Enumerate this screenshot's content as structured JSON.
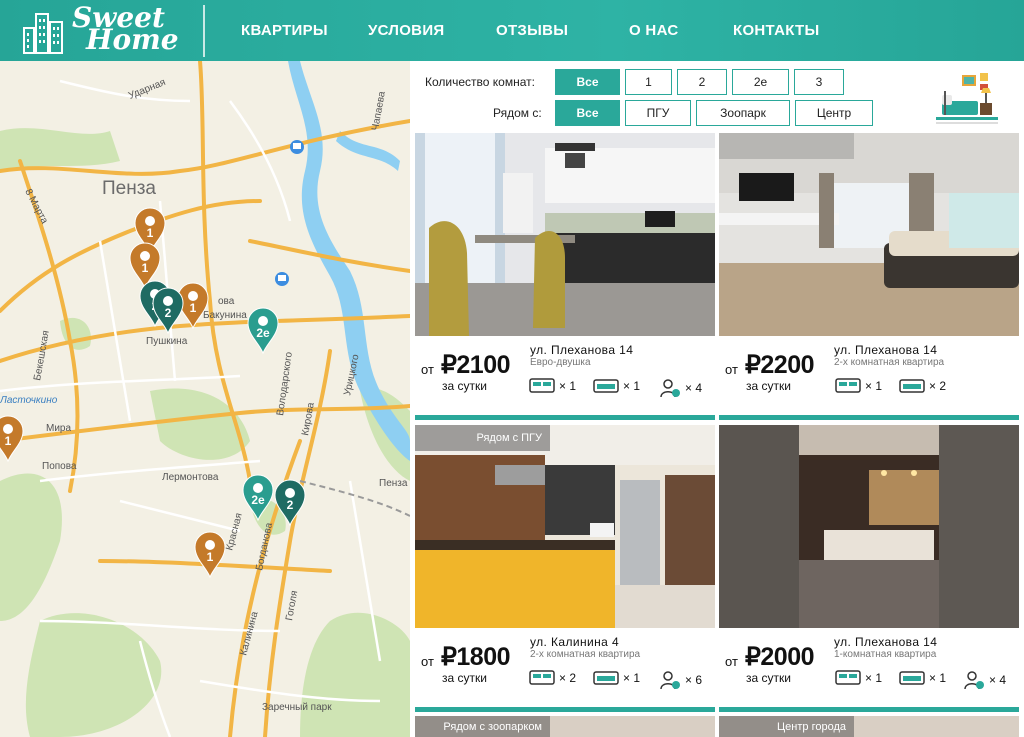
{
  "brand": {
    "line1": "Sweet",
    "line2": "Home"
  },
  "nav": [
    "КВАРТИРЫ",
    "УСЛОВИЯ",
    "ОТЗЫВЫ",
    "О НАС",
    "КОНТАКТЫ"
  ],
  "filters": {
    "rooms_label": "Количество комнат:",
    "rooms_options": [
      "Все",
      "1",
      "2",
      "2е",
      "3"
    ],
    "rooms_selected": "Все",
    "near_label": "Рядом с:",
    "near_options": [
      "Все",
      "ПГУ",
      "Зоопарк",
      "Центр"
    ],
    "near_selected": "Все"
  },
  "map": {
    "city": "Пенза",
    "streets": [
      "Ударная",
      "8 Марта",
      "Бекешская",
      "Пушкина",
      "Мира",
      "Попова",
      "Лермонтова",
      "Володарского",
      "Кирова",
      "Урицкого",
      "Чапаева",
      "Красная",
      "Богданова",
      "Гоголя",
      "Калинина",
      "Заречный парк",
      "Пенза",
      "Ласточкино",
      "ова",
      "Бакунина"
    ],
    "markers": [
      "1",
      "1",
      "1",
      "2",
      "2",
      "2е",
      "1",
      "2е",
      "2",
      "1"
    ]
  },
  "listings": [
    {
      "tag": "",
      "from": "от",
      "price": "₽2100",
      "per": "за сутки",
      "address": "ул. Плеханова 14",
      "type": "Евро-двушка",
      "beds": "× 1",
      "sofas": "× 1",
      "guests": "× 4"
    },
    {
      "tag": "",
      "from": "от",
      "price": "₽2200",
      "per": "за сутки",
      "address": "ул. Плеханова 14",
      "type": "2-х комнатная квартира",
      "beds": "× 1",
      "sofas": "× 2",
      "guests": ""
    },
    {
      "tag": "Рядом с ПГУ",
      "from": "от",
      "price": "₽1800",
      "per": "за сутки",
      "address": "ул. Калинина 4",
      "type": "2-х комнатная квартира",
      "beds": "× 2",
      "sofas": "× 1",
      "guests": "× 6"
    },
    {
      "tag": "",
      "from": "от",
      "price": "₽2000",
      "per": "за сутки",
      "address": "ул. Плеханова 14",
      "type": "1-комнатная квартира",
      "beds": "× 1",
      "sofas": "× 1",
      "guests": "× 4"
    }
  ],
  "more_tags": [
    "Рядом с зоопарком",
    "Центр города"
  ],
  "colors": {
    "accent": "#2aa89a",
    "marker_orange": "#c47a2a",
    "marker_teal": "#2a9d8f",
    "marker_dark": "#1f6b63"
  }
}
